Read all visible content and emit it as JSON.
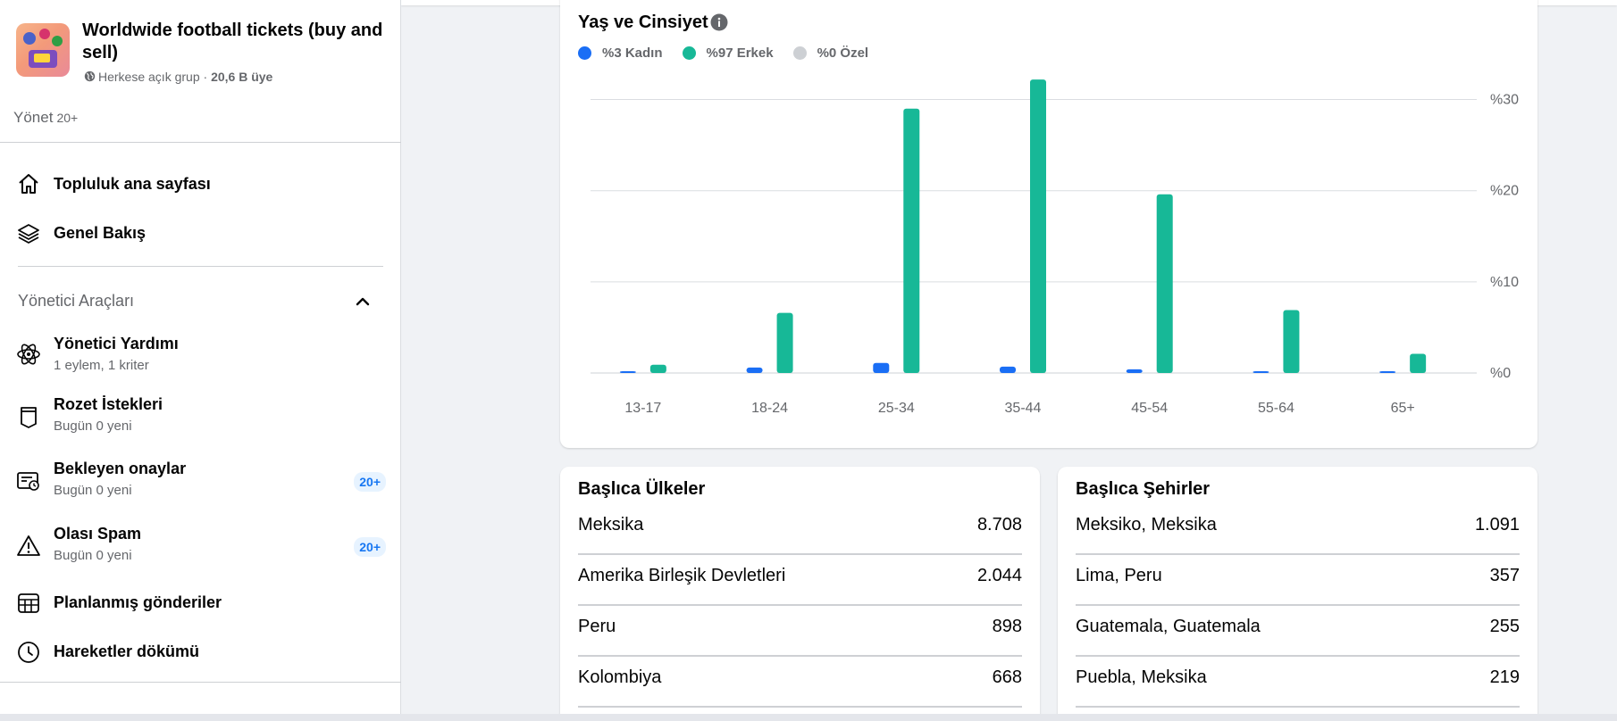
{
  "group": {
    "title": "Worldwide football tickets (buy and sell)",
    "privacy": "Herkese açık grup",
    "separator": " · ",
    "members": "20,6 B üye"
  },
  "manage": {
    "label": "Yönet",
    "count": "20+"
  },
  "nav": {
    "home": "Topluluk ana sayfası",
    "overview": "Genel Bakış"
  },
  "admin_tools": {
    "title": "Yönetici Araçları",
    "items": [
      {
        "label": "Yönetici Yardımı",
        "sub": "1 eylem, 1 kriter",
        "badge": ""
      },
      {
        "label": "Rozet İstekleri",
        "sub": "Bugün 0 yeni",
        "badge": ""
      },
      {
        "label": "Bekleyen onaylar",
        "sub": "Bugün 0 yeni",
        "badge": "20+"
      },
      {
        "label": "Olası Spam",
        "sub": "Bugün 0 yeni",
        "badge": "20+"
      },
      {
        "label": "Planlanmış gönderiler",
        "sub": "",
        "badge": ""
      },
      {
        "label": "Hareketler dökümü",
        "sub": "",
        "badge": ""
      }
    ]
  },
  "chart_card": {
    "title": "Yaş ve Cinsiyet",
    "legend": [
      {
        "label": "%3 Kadın",
        "color": "#1a6ef5"
      },
      {
        "label": "%97 Erkek",
        "color": "#17b897"
      },
      {
        "label": "%0 Özel",
        "color": "#cdd0d4"
      }
    ]
  },
  "chart_data": {
    "type": "bar",
    "categories": [
      "13-17",
      "18-24",
      "25-34",
      "35-44",
      "45-54",
      "55-64",
      "65+"
    ],
    "series": [
      {
        "name": "%3 Kadın",
        "values": [
          0.1,
          0.6,
          1.1,
          0.7,
          0.4,
          0.1,
          0.1
        ],
        "color": "#1a6ef5"
      },
      {
        "name": "%97 Erkek",
        "values": [
          0.9,
          6.6,
          29.0,
          32.2,
          19.6,
          6.9,
          2.1
        ],
        "color": "#17b897"
      }
    ],
    "yticks": [
      "%0",
      "%10",
      "%20",
      "%30"
    ],
    "ylim": [
      0,
      32.5
    ],
    "grid": true,
    "legend": "top-left"
  },
  "countries": {
    "title": "Başlıca Ülkeler",
    "rows": [
      {
        "name": "Meksika",
        "value": "8.708"
      },
      {
        "name": "Amerika Birleşik Devletleri",
        "value": "2.044"
      },
      {
        "name": "Peru",
        "value": "898"
      },
      {
        "name": "Kolombiya",
        "value": "668"
      }
    ]
  },
  "cities": {
    "title": "Başlıca Şehirler",
    "rows": [
      {
        "name": "Meksiko, Meksika",
        "value": "1.091"
      },
      {
        "name": "Lima, Peru",
        "value": "357"
      },
      {
        "name": "Guatemala, Guatemala",
        "value": "255"
      },
      {
        "name": "Puebla, Meksika",
        "value": "219"
      }
    ]
  }
}
